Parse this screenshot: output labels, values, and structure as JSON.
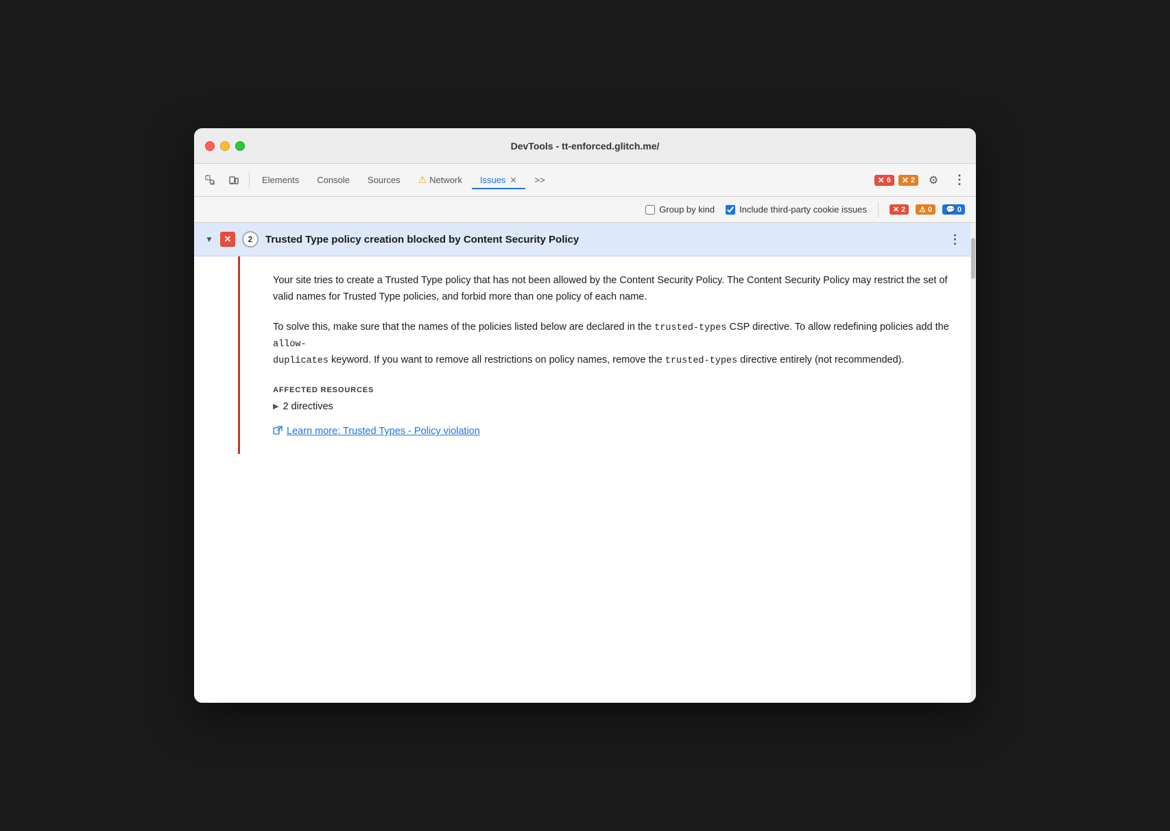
{
  "window": {
    "title": "DevTools - tt-enforced.glitch.me/"
  },
  "toolbar": {
    "tabs": [
      {
        "id": "elements",
        "label": "Elements",
        "active": false
      },
      {
        "id": "console",
        "label": "Console",
        "active": false
      },
      {
        "id": "sources",
        "label": "Sources",
        "active": false
      },
      {
        "id": "network",
        "label": "Network",
        "active": false,
        "hasWarning": true
      },
      {
        "id": "issues",
        "label": "Issues",
        "active": true,
        "hasClose": true
      }
    ],
    "more_tabs_label": ">>",
    "error_badge_count": "6",
    "warning_badge_count": "2"
  },
  "subbar": {
    "group_by_kind_label": "Group by kind",
    "include_third_party_label": "Include third-party cookie issues",
    "error_count": "2",
    "warning_count": "0",
    "info_count": "0"
  },
  "issue": {
    "count": "2",
    "title": "Trusted Type policy creation blocked by Content Security Policy",
    "description": "Your site tries to create a Trusted Type policy that has not been allowed by the Content Security Policy. The Content Security Policy may restrict the set of valid names for Trusted Type policies, and forbid more than one policy of each name.",
    "solution_part1": "To solve this, make sure that the names of the policies listed below are declared in the ",
    "csp_directive": "trusted-types",
    "solution_part2": " CSP directive. To allow redefining policies add the ",
    "allow_duplicates": "allow-\nduplicates",
    "solution_part3": " keyword. If you want to remove all restrictions on policy names, remove the ",
    "trusted_types2": "trusted-types",
    "solution_part4": " directive entirely (not recommended).",
    "affected_resources_label": "AFFECTED RESOURCES",
    "directives_label": "2 directives",
    "learn_more_text": "Learn more: Trusted Types - Policy violation"
  }
}
